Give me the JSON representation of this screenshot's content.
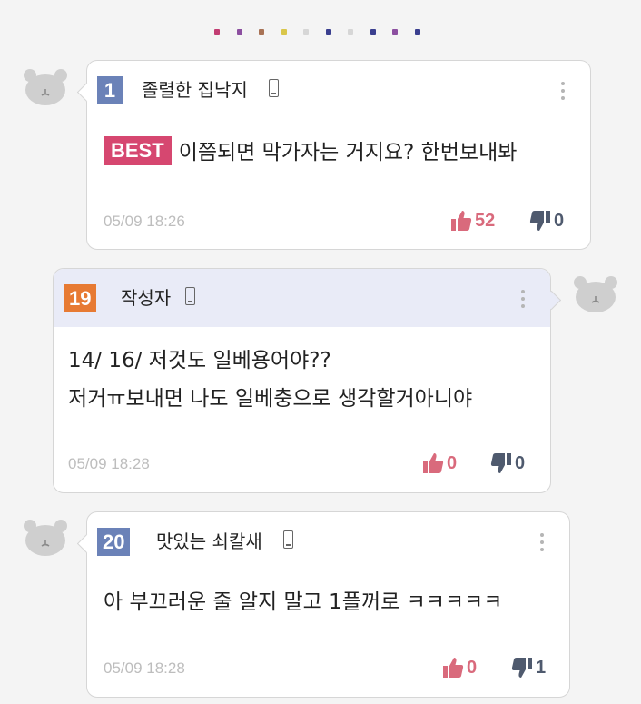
{
  "colors": {
    "badge_blue": "#6b82b8",
    "badge_orange": "#e77a33",
    "best": "#d64770",
    "like": "#d96a7c",
    "dislike": "#4f5a6e",
    "mine_header": "#e9ebf7"
  },
  "progress_dots": [
    "#c23d72",
    "#8c4fa0",
    "#a87255",
    "#d9c64a",
    "#d6d6d6",
    "#3a3f8f",
    "#d6d6d6",
    "#3a3f8f",
    "#8c4fa0",
    "#3a3f8f"
  ],
  "comments": [
    {
      "number": "1",
      "nickname": "졸렬한 집낙지",
      "best_label": "BEST",
      "text": "이쯤되면 막가자는 거지요? 한번보내봐",
      "timestamp": "05/09 18:26",
      "likes": "52",
      "dislikes": "0"
    },
    {
      "number": "19",
      "nickname": "작성자",
      "lines": [
        "14/ 16/ 저것도 일베용어야??",
        "저거ㅠ보내면 나도 일베충으로 생각할거아니야"
      ],
      "timestamp": "05/09 18:28",
      "likes": "0",
      "dislikes": "0"
    },
    {
      "number": "20",
      "nickname": "맛있는 쇠칼새",
      "text": "아 부끄러운 줄 알지 말고 1플꺼로 ㅋㅋㅋㅋㅋ",
      "timestamp": "05/09 18:28",
      "likes": "0",
      "dislikes": "1"
    }
  ]
}
